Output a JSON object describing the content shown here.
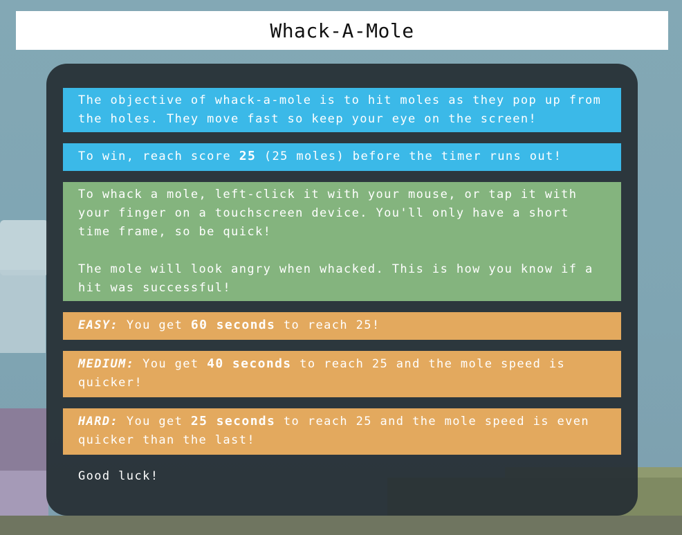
{
  "title": "Whack-A-Mole",
  "instructions": {
    "objective": "The objective of whack-a-mole is to hit moles as they pop up from the holes. They move fast so keep your eye on the screen!",
    "win_prefix": "To win, reach score ",
    "win_score": "25",
    "win_suffix": " (25 moles) before the timer runs out!",
    "how_to_whack": "To whack a mole, left-click it with your mouse, or tap it with your finger on a touchscreen device. You'll only have a short time frame, so be quick!",
    "angry_note": "The mole will look angry when whacked. This is how you know if a hit was successful!",
    "easy": {
      "label": "EASY:",
      "prefix": " You get ",
      "seconds": "60 seconds",
      "suffix": " to reach 25!"
    },
    "medium": {
      "label": "MEDIUM:",
      "prefix": " You get ",
      "seconds": "40 seconds",
      "suffix": " to reach 25 and the mole speed is quicker!"
    },
    "hard": {
      "label": "HARD:",
      "prefix": " You get ",
      "seconds": "25 seconds",
      "suffix": " to reach 25 and the mole speed is even quicker than the last!"
    },
    "good_luck": "Good luck!"
  },
  "colors": {
    "blue_box": "#3bb9e8",
    "green_box": "#84b47e",
    "orange_box": "#e3a95e",
    "panel": "#262e34"
  }
}
